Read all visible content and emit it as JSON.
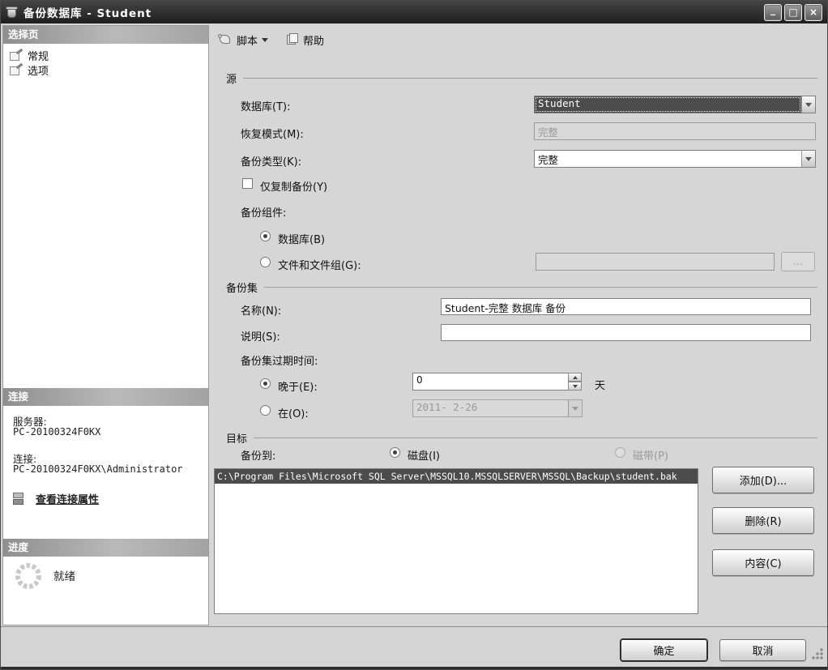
{
  "window": {
    "title": "备份数据库 - Student",
    "controls": {
      "minimize": "_",
      "maximize": "□",
      "close": "×"
    }
  },
  "colors": {
    "titlebar": "#262626",
    "panel_header": "#9a9a9a",
    "selection": "#4c4c4c",
    "background": "#d6d6d6"
  },
  "sidebar": {
    "select_page_header": "选择页",
    "pages": [
      {
        "label": "常规"
      },
      {
        "label": "选项"
      }
    ],
    "connection_header": "连接",
    "server_label": "服务器:",
    "server_value": "PC-20100324F0KX",
    "connection_label": "连接:",
    "connection_value": "PC-20100324F0KX\\Administrator",
    "view_connection_properties": "查看连接属性",
    "progress_header": "进度",
    "progress_status": "就绪"
  },
  "toolbar": {
    "script_label": "脚本",
    "help_label": "帮助"
  },
  "source_section": {
    "title": "源",
    "database_label": "数据库(T):",
    "database_value": "Student",
    "recovery_model_label": "恢复模式(M):",
    "recovery_model_value": "完整",
    "backup_type_label": "备份类型(K):",
    "backup_type_value": "完整",
    "copy_only_label": "仅复制备份(Y)",
    "component_label": "备份组件:",
    "database_radio_label": "数据库(B)",
    "files_radio_label": "文件和文件组(G):",
    "browse_button": "..."
  },
  "backup_set_section": {
    "title": "备份集",
    "name_label": "名称(N):",
    "name_value": "Student-完整 数据库 备份",
    "description_label": "说明(S):",
    "description_value": "",
    "expiration_label": "备份集过期时间:",
    "after_label": "晚于(E):",
    "after_value": "0",
    "after_unit": "天",
    "on_label": "在(O):",
    "on_value": "2011- 2-26"
  },
  "destination_section": {
    "title": "目标",
    "backup_to_label": "备份到:",
    "disk_label": "磁盘(I)",
    "tape_label": "磁带(P)",
    "paths": [
      "C:\\Program Files\\Microsoft SQL Server\\MSSQL10.MSSQLSERVER\\MSSQL\\Backup\\student.bak"
    ],
    "add_button": "添加(D)...",
    "remove_button": "删除(R)",
    "contents_button": "内容(C)"
  },
  "footer": {
    "ok_button": "确定",
    "cancel_button": "取消"
  }
}
